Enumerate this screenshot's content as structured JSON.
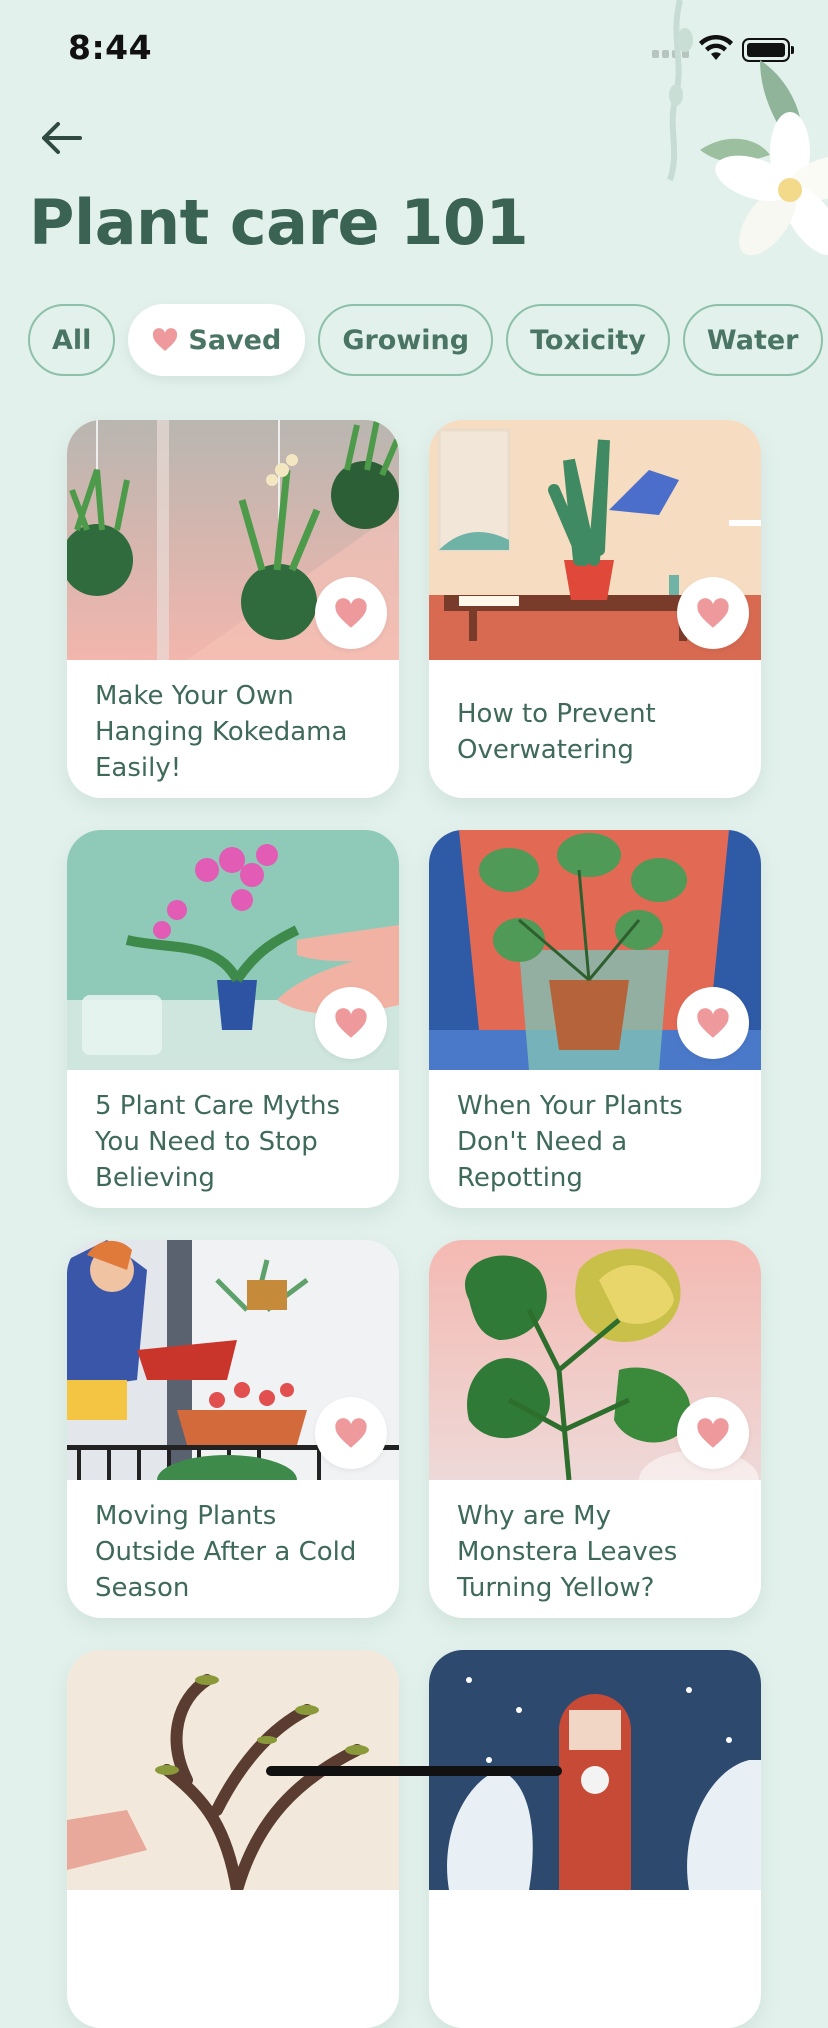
{
  "status": {
    "time": "8:44"
  },
  "header": {
    "title": "Plant care 101"
  },
  "filters": [
    {
      "label": "All",
      "active": false
    },
    {
      "label": "Saved",
      "active": true
    },
    {
      "label": "Growing",
      "active": false
    },
    {
      "label": "Toxicity",
      "active": false
    },
    {
      "label": "Water",
      "active": false
    }
  ],
  "articles": [
    {
      "title": "Make Your Own Hanging Kokedama Easily!",
      "image": "kokedama-illustration"
    },
    {
      "title": "How to Prevent Overwatering",
      "image": "overwatering-illustration"
    },
    {
      "title": "5 Plant Care Myths You Need to Stop Believing",
      "image": "orchid-illustration"
    },
    {
      "title": "When Your Plants Don't Need a Repotting",
      "image": "repotting-illustration"
    },
    {
      "title": "Moving Plants Outside After a Cold Season",
      "image": "balcony-illustration"
    },
    {
      "title": "Why are My Monstera Leaves Turning Yellow?",
      "image": "monstera-illustration"
    }
  ],
  "colors": {
    "background": "#e3f1ec",
    "title": "#3a6353",
    "chip_border": "#8cc0a9",
    "heart": "#ee9a9c"
  }
}
